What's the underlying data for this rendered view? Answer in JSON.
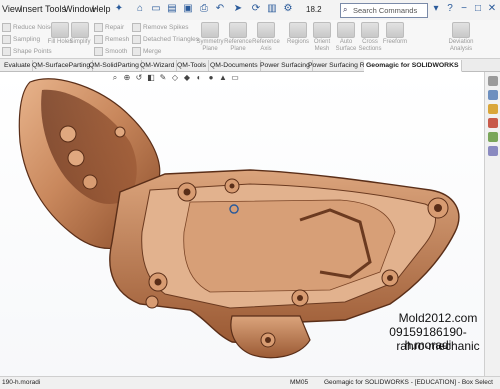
{
  "menu": {
    "items": [
      "View",
      "Insert",
      "Tools",
      "Window",
      "Help"
    ]
  },
  "toolbar": {
    "zoom": "18.2",
    "search_placeholder": "Search Commands"
  },
  "ribbon": {
    "small_left": [
      "Reduce Noise",
      "Sampling",
      "Shape Points"
    ],
    "big_a": [
      "Fill Holes",
      "Simplify"
    ],
    "small_mid": [
      "Repair",
      "Remesh",
      "Smooth"
    ],
    "small_mid2": [
      "Remove Spikes",
      "Detached Triangles",
      "Merge"
    ],
    "big_b": [
      "Symmetry Plane",
      "Reference Plane",
      "Reference Axis",
      "Regions",
      "Orient Mesh",
      "Auto Surface",
      "Cross Sections",
      "Freeform",
      "Deviation Analysis"
    ]
  },
  "tabs": [
    "Evaluate",
    "QM-SurfaceParting",
    "QM-SolidParting",
    "QM-Wizard",
    "QM-Tools",
    "QM-Documents",
    "Power Surfacing",
    "Power Surfacing RE",
    "Geomagic for SOLIDWORKS"
  ],
  "active_tab": "Geomagic for SOLIDWORKS",
  "watermark": {
    "line1": "Mold2012.com",
    "line2": "09159186190-h.moradi",
    "line3": "rahro-mechanic"
  },
  "status": {
    "left": "190-h.moradi",
    "mid": "MM05",
    "right": "Geomagic for SOLIDWORKS - [EDUCATION] - Box Select"
  },
  "colors": {
    "part": "#c98c62",
    "part_dark": "#5a2e18",
    "accent": "#2a5a9a"
  }
}
